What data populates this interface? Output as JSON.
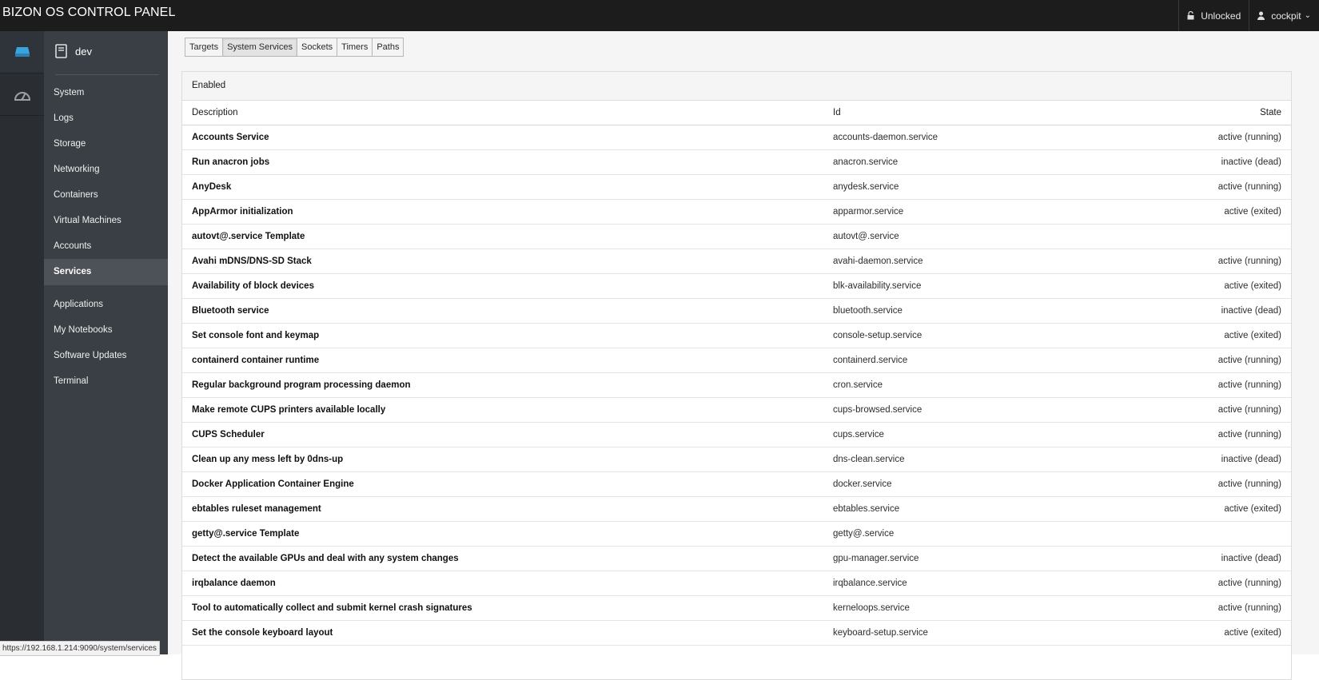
{
  "app": {
    "title": "BIZON OS CONTROL PANEL",
    "lock_status": "Unlocked",
    "user": "cockpit"
  },
  "host": {
    "name": "dev"
  },
  "nav": {
    "items": [
      {
        "label": "System"
      },
      {
        "label": "Logs"
      },
      {
        "label": "Storage"
      },
      {
        "label": "Networking"
      },
      {
        "label": "Containers"
      },
      {
        "label": "Virtual Machines"
      },
      {
        "label": "Accounts"
      },
      {
        "label": "Services",
        "active": true
      },
      {
        "label": "Applications"
      },
      {
        "label": "My Notebooks"
      },
      {
        "label": "Software Updates"
      },
      {
        "label": "Terminal"
      }
    ]
  },
  "tabs": [
    {
      "label": "Targets"
    },
    {
      "label": "System Services",
      "active": true
    },
    {
      "label": "Sockets"
    },
    {
      "label": "Timers"
    },
    {
      "label": "Paths"
    }
  ],
  "panel": {
    "heading": "Enabled",
    "columns": {
      "description": "Description",
      "id": "Id",
      "state": "State"
    },
    "rows": [
      {
        "description": "Accounts Service",
        "id": "accounts-daemon.service",
        "state": "active (running)"
      },
      {
        "description": "Run anacron jobs",
        "id": "anacron.service",
        "state": "inactive (dead)"
      },
      {
        "description": "AnyDesk",
        "id": "anydesk.service",
        "state": "active (running)"
      },
      {
        "description": "AppArmor initialization",
        "id": "apparmor.service",
        "state": "active (exited)"
      },
      {
        "description": "autovt@.service Template",
        "id": "autovt@.service",
        "state": ""
      },
      {
        "description": "Avahi mDNS/DNS-SD Stack",
        "id": "avahi-daemon.service",
        "state": "active (running)"
      },
      {
        "description": "Availability of block devices",
        "id": "blk-availability.service",
        "state": "active (exited)"
      },
      {
        "description": "Bluetooth service",
        "id": "bluetooth.service",
        "state": "inactive (dead)"
      },
      {
        "description": "Set console font and keymap",
        "id": "console-setup.service",
        "state": "active (exited)"
      },
      {
        "description": "containerd container runtime",
        "id": "containerd.service",
        "state": "active (running)"
      },
      {
        "description": "Regular background program processing daemon",
        "id": "cron.service",
        "state": "active (running)"
      },
      {
        "description": "Make remote CUPS printers available locally",
        "id": "cups-browsed.service",
        "state": "active (running)"
      },
      {
        "description": "CUPS Scheduler",
        "id": "cups.service",
        "state": "active (running)"
      },
      {
        "description": "Clean up any mess left by 0dns-up",
        "id": "dns-clean.service",
        "state": "inactive (dead)"
      },
      {
        "description": "Docker Application Container Engine",
        "id": "docker.service",
        "state": "active (running)"
      },
      {
        "description": "ebtables ruleset management",
        "id": "ebtables.service",
        "state": "active (exited)"
      },
      {
        "description": "getty@.service Template",
        "id": "getty@.service",
        "state": ""
      },
      {
        "description": "Detect the available GPUs and deal with any system changes",
        "id": "gpu-manager.service",
        "state": "inactive (dead)"
      },
      {
        "description": "irqbalance daemon",
        "id": "irqbalance.service",
        "state": "active (running)"
      },
      {
        "description": "Tool to automatically collect and submit kernel crash signatures",
        "id": "kerneloops.service",
        "state": "active (running)"
      },
      {
        "description": "Set the console keyboard layout",
        "id": "keyboard-setup.service",
        "state": "active (exited)"
      }
    ]
  },
  "status_bar": {
    "url": "https://192.168.1.214:9090/system/services"
  },
  "icons": {
    "lock": "lock-icon",
    "user": "user-icon",
    "dashboard": "dashboard-icon",
    "host": "server-icon",
    "gauge": "gauge-icon"
  },
  "colors": {
    "topbar": "#1c1c1c",
    "rail": "#2a2e33",
    "sidenav": "#393f44",
    "nav_active": "#4d5258",
    "host_icon_accent": "#39a5dc"
  }
}
